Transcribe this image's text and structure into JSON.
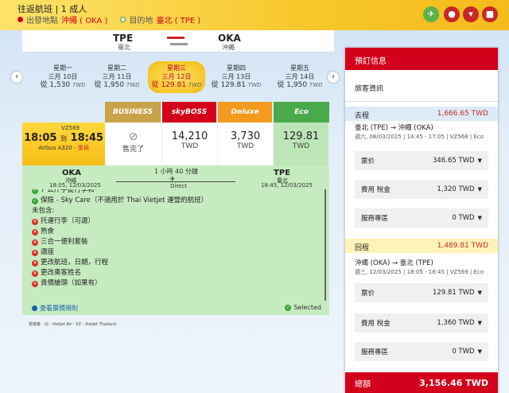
{
  "header": {
    "title": "往返航班 | 1 成人",
    "origin_label": "出發地點",
    "origin_value": "沖繩 ( OKA )",
    "dest_label": "目的地",
    "dest_value": "臺北 ( TPE )"
  },
  "route": {
    "from_code": "TPE",
    "from_city": "臺北",
    "to_code": "OKA",
    "to_city": "沖繩"
  },
  "dates": [
    {
      "day": "星期一",
      "date": "三月 10日",
      "price": "從 1,530",
      "cur": "TWD"
    },
    {
      "day": "星期二",
      "date": "三月 11日",
      "price": "從 1,950",
      "cur": "TWD"
    },
    {
      "day": "星期三",
      "date": "三月 12日",
      "price": "從 129.81",
      "cur": "TWD"
    },
    {
      "day": "星期四",
      "date": "三月 13日",
      "price": "從 129.81",
      "cur": "TWD"
    },
    {
      "day": "星期五",
      "date": "三月 14日",
      "price": "從 1,950",
      "cur": "TWD"
    }
  ],
  "fare_tabs": {
    "business": "BUSINESS",
    "skyboss": "skyBOSS",
    "deluxe": "Deluxe",
    "eco": "Eco"
  },
  "colors": {
    "business": "#c9a34a",
    "skyboss": "#d3001c",
    "deluxe": "#f39a1f",
    "eco": "#4aa94a",
    "brand_red": "#d3001c"
  },
  "flight": {
    "number": "VZ569",
    "depart": "18:05",
    "to_word": "到",
    "arrive": "18:45",
    "aircraft": "Airbus A320 - ",
    "sel_tag": "重視"
  },
  "fares": {
    "business": "售完了",
    "skyboss_amt": "14,210",
    "skyboss_cur": "TWD",
    "deluxe_amt": "3,730",
    "deluxe_cur": "TWD",
    "eco_amt": "129.81",
    "eco_cur": "TWD"
  },
  "detail": {
    "from_code": "OKA",
    "from_city": "沖繩",
    "from_time": "18:05, 12/03/2025",
    "duration": "1 小時 40 分鐘",
    "direct": "Direct",
    "to_code": "TPE",
    "to_city": "臺北",
    "to_time": "18:45, 12/03/2025",
    "included": [
      "7 公斤手提行李和",
      "保險 - Sky Care（不適用於 Thai Vietjet 運營的航班）"
    ],
    "excluded_title": "未包含:",
    "excluded": [
      "托運行李（可選）",
      "熱食",
      "三合一便利套裝",
      "選座",
      "更改航班，日期，行程",
      "更改乘客姓名",
      "貴價艙頭（如果有）"
    ],
    "rules": "查看票價規則",
    "selected": "Selected"
  },
  "legend": "營運者 · VJ - Vietjet Air · VZ - Vietjet Thailand",
  "panel": {
    "title": "預訂信息",
    "pax": "旅客資訊",
    "out_label": "去程",
    "out_total": "1,666.65 TWD",
    "out_route": "臺北 (TPE) → 沖繩 (OKA)",
    "out_meta": "週六, 08/03/2025 | 14:45 - 17:05 | VZ568 | Eco",
    "out_rows": [
      {
        "label": "票价",
        "value": "346.65 TWD"
      },
      {
        "label": "費用 稅金",
        "value": "1,320 TWD"
      },
      {
        "label": "服務專區",
        "value": "0 TWD"
      }
    ],
    "ret_label": "回程",
    "ret_total": "1,489.81 TWD",
    "ret_route": "沖繩 (OKA) → 臺北 (TPE)",
    "ret_meta": "週三, 12/03/2025 | 18:05 - 18:45 | VZ569 | Eco",
    "ret_rows": [
      {
        "label": "票价",
        "value": "129.81 TWD"
      },
      {
        "label": "費用 稅金",
        "value": "1,360 TWD"
      },
      {
        "label": "服務專區",
        "value": "0 TWD"
      }
    ],
    "total_label": "總額",
    "total_value": "3,156.46 TWD"
  }
}
